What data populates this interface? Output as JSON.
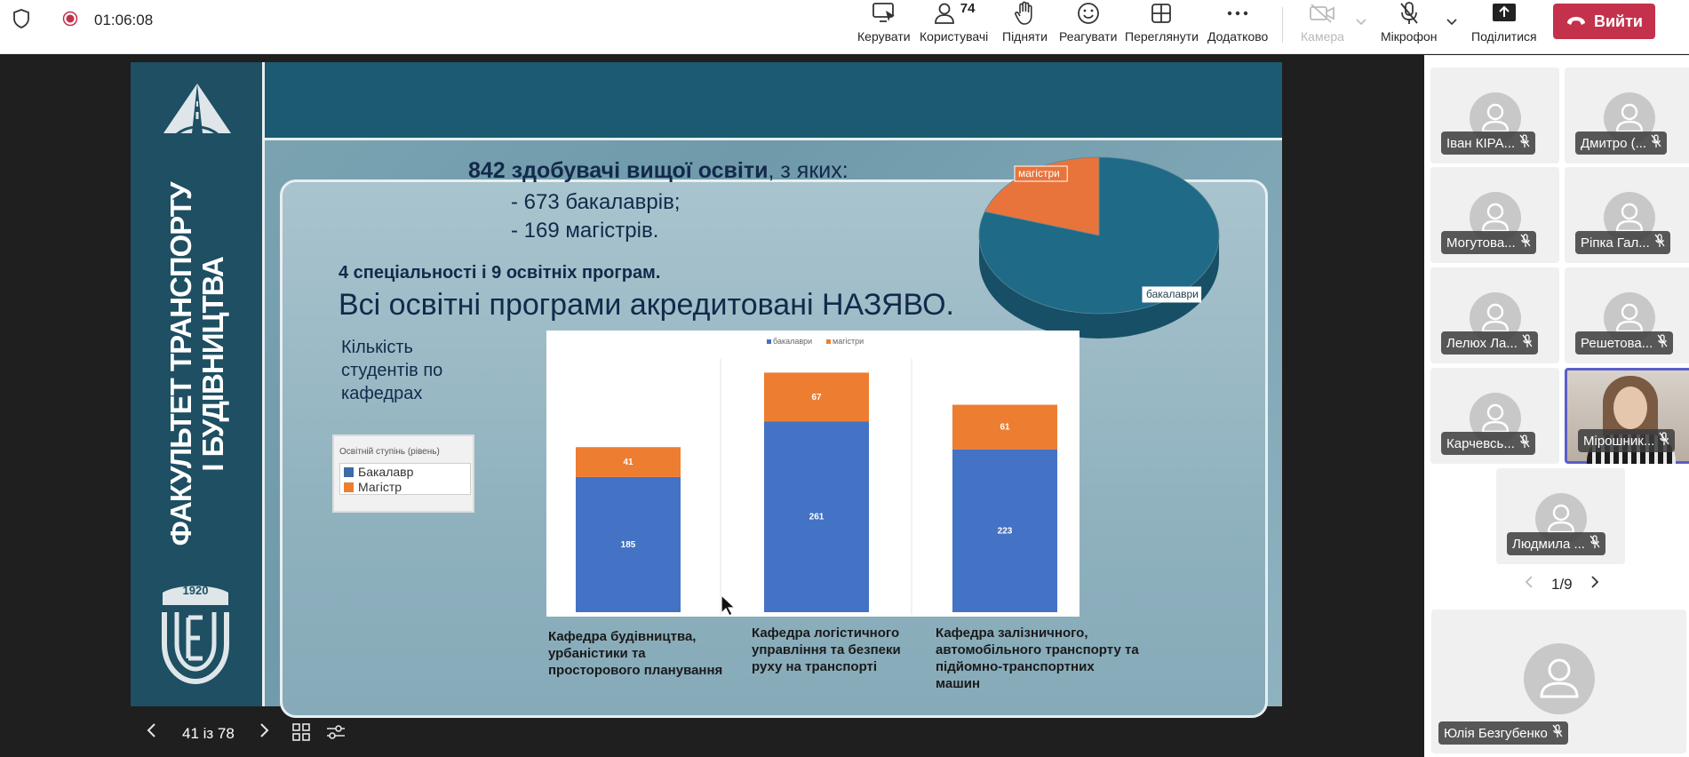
{
  "topbar": {
    "timer": "01:06:08",
    "buttons": [
      {
        "label": "Керувати",
        "icon": "screen-control-icon"
      },
      {
        "label": "Користувачі",
        "icon": "people-icon",
        "badge": "74"
      },
      {
        "label": "Підняти",
        "icon": "raise-hand-icon"
      },
      {
        "label": "Реагувати",
        "icon": "smile-icon"
      },
      {
        "label": "Переглянути",
        "icon": "grid-view-icon"
      },
      {
        "label": "Додатково",
        "icon": "more-icon"
      },
      {
        "label": "Камера",
        "icon": "camera-off-icon"
      },
      {
        "label": "Мікрофон",
        "icon": "mic-off-icon"
      },
      {
        "label": "Поділитися",
        "icon": "share-icon"
      }
    ],
    "leave_label": "Вийти",
    "accent": "#c4314b"
  },
  "slide": {
    "vertical_title_1": "ФАКУЛЬТЕТ ТРАНСПОРТУ",
    "vertical_title_2": "І БУДІВНИЦТВА",
    "logo_year": "1920",
    "line1_bold": "842 здобувачі вищої освіти",
    "line1_rest": ", з яких:",
    "line2": "-   673 бакалаврів;",
    "line3": "-   169 магістрів.",
    "line4": "4 спеціальності і 9 освітніх програм.",
    "line5": "Всі освітні програми акредитовані НАЗЯВО.",
    "kafedry_label": "Кількість студентів по кафедрах",
    "legend_title": "Освітній ступінь (рівень)",
    "legend_items": [
      "Бакалавр",
      "Магістр"
    ],
    "captions": [
      "Кафедра будівництва, урбаністики та просторового планування",
      "Кафедра логістичного управління та безпеки руху на транспорті",
      "Кафедра  залізничного, автомобільного  транспорту та  підйомно-транспортних машин"
    ]
  },
  "chart_data": [
    {
      "type": "pie",
      "categories": [
        "бакалаври",
        "магістри"
      ],
      "values": [
        673,
        169
      ],
      "colors": [
        "#1e6a87",
        "#e8743b"
      ]
    },
    {
      "type": "bar",
      "stacked": true,
      "categories": [
        "Кафедра будівництва",
        "Кафедра логістичного",
        "Кафедра залізничного"
      ],
      "legend": [
        "бакалаври",
        "магістри"
      ],
      "series": [
        {
          "name": "бакалаври",
          "values": [
            185,
            261,
            223
          ],
          "color": "#4472c4"
        },
        {
          "name": "магістри",
          "values": [
            41,
            67,
            61
          ],
          "color": "#ed7d31"
        }
      ]
    }
  ],
  "presenter_nav": {
    "page_text": "41 із 78"
  },
  "gallery": {
    "participants": [
      "Іван КІРА...",
      "Дмитро (...",
      "Могутова...",
      "Ріпка Гал...",
      "Лелюх Ла...",
      "Решетова...",
      "Карчевсь...",
      "Мірошник...",
      "Людмила ..."
    ],
    "pager": "1/9",
    "active": "Юлія Безгубенко"
  }
}
